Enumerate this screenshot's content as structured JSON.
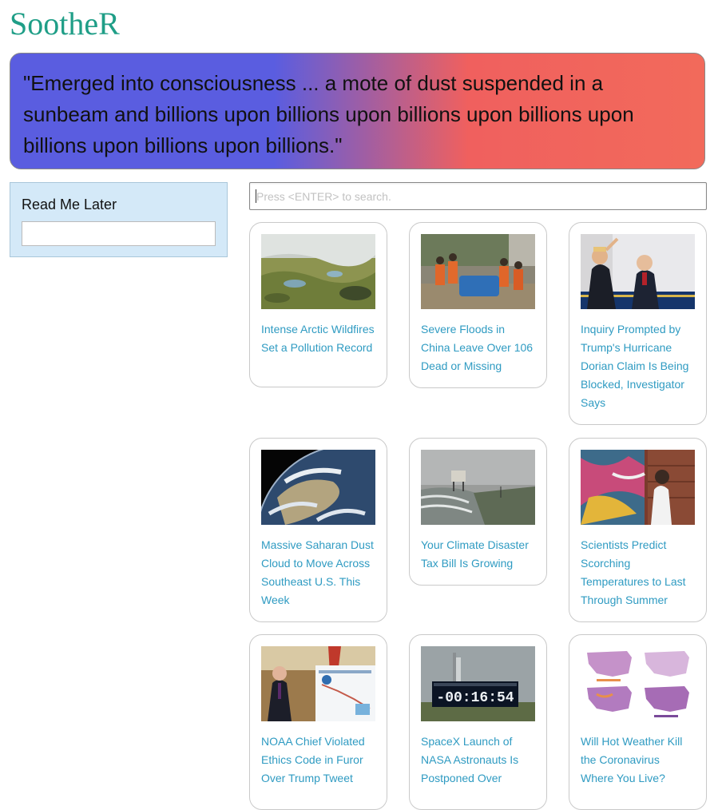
{
  "app": {
    "logo": "SootheR"
  },
  "quote": {
    "text": "\"Emerged into consciousness ... a mote of dust suspended in a sunbeam and billions upon billions upon billions upon billions upon billions upon billions upon billions.\""
  },
  "read_later": {
    "title": "Read Me Later",
    "input_value": ""
  },
  "search": {
    "placeholder": "Press <ENTER> to search.",
    "value": ""
  },
  "articles": [
    {
      "title": "Intense Arctic Wildfires Set a Pollution Record",
      "image": "arctic-wildfire-smoke"
    },
    {
      "title": "Severe Floods in China Leave Over 106 Dead or Missing",
      "image": "flood-rescue-boat"
    },
    {
      "title": "Inquiry Prompted by Trump's Hurricane Dorian Claim Is Being Blocked, Investigator Says",
      "image": "trump-and-official"
    },
    {
      "title": "Massive Saharan Dust Cloud to Move Across Southeast U.S. This Week",
      "image": "earth-from-space"
    },
    {
      "title": "Your Climate Disaster Tax Bill Is Growing",
      "image": "storm-surge-coast"
    },
    {
      "title": "Scientists Predict Scorching Temperatures to Last Through Summer",
      "image": "mural-heat"
    },
    {
      "title": "NOAA Chief Violated Ethics Code in Furor Over Trump Tweet",
      "image": "noaa-chart-oval-office"
    },
    {
      "title": "SpaceX Launch of NASA Astronauts Is Postponed Over",
      "image": "countdown-clock",
      "clock": "-00:16:54"
    },
    {
      "title": "Will Hot Weather Kill the Coronavirus Where You Live?",
      "image": "us-heat-maps"
    }
  ]
}
